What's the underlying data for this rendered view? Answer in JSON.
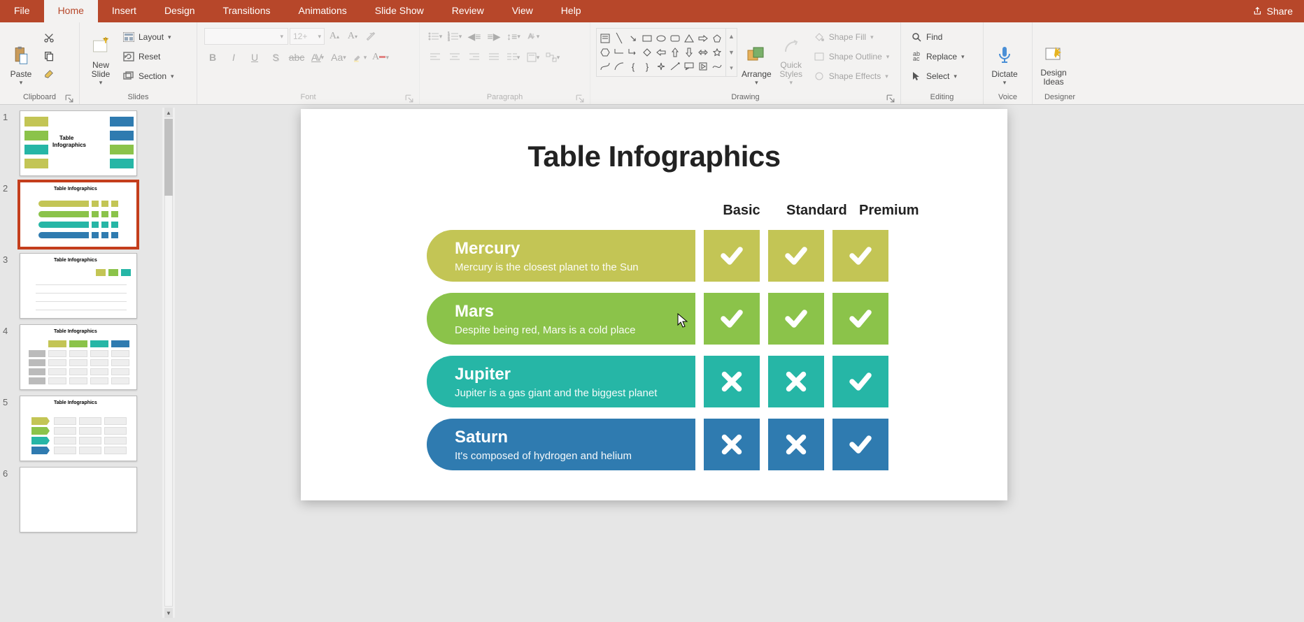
{
  "tabs": [
    "File",
    "Home",
    "Insert",
    "Design",
    "Transitions",
    "Animations",
    "Slide Show",
    "Review",
    "View",
    "Help"
  ],
  "active_tab": "Home",
  "share": "Share",
  "groups": {
    "clipboard": "Clipboard",
    "slides": "Slides",
    "font": "Font",
    "paragraph": "Paragraph",
    "drawing": "Drawing",
    "editing": "Editing",
    "voice": "Voice",
    "designer": "Designer"
  },
  "ribbon": {
    "paste": "Paste",
    "new_slide": "New\nSlide",
    "layout": "Layout",
    "reset": "Reset",
    "section": "Section",
    "font_name": "",
    "font_size": "12+",
    "arrange": "Arrange",
    "quick_styles": "Quick\nStyles",
    "shape_fill": "Shape Fill",
    "shape_outline": "Shape Outline",
    "shape_effects": "Shape Effects",
    "find": "Find",
    "replace": "Replace",
    "select": "Select",
    "dictate": "Dictate",
    "design_ideas": "Design\nIdeas"
  },
  "thumbnails": [
    {
      "n": 1,
      "title": "Table Infographics"
    },
    {
      "n": 2,
      "title": "Table Infographics"
    },
    {
      "n": 3,
      "title": "Table Infographics"
    },
    {
      "n": 4,
      "title": "Table Infographics"
    },
    {
      "n": 5,
      "title": "Table Infographics"
    },
    {
      "n": 6,
      "title": ""
    }
  ],
  "selected_thumb": 2,
  "slide": {
    "title": "Table Infographics",
    "columns": [
      "Basic",
      "Standard",
      "Premium"
    ],
    "rows": [
      {
        "title": "Mercury",
        "sub": "Mercury is the closest planet to the Sun",
        "color": "c-olive",
        "cells": [
          "check",
          "check",
          "check"
        ]
      },
      {
        "title": "Mars",
        "sub": "Despite being red, Mars is a cold place",
        "color": "c-green",
        "cells": [
          "check",
          "check",
          "check"
        ]
      },
      {
        "title": "Jupiter",
        "sub": "Jupiter is a gas giant and the biggest planet",
        "color": "c-teal",
        "cells": [
          "cross",
          "cross",
          "check"
        ]
      },
      {
        "title": "Saturn",
        "sub": "It's composed of hydrogen and helium",
        "color": "c-blue",
        "cells": [
          "cross",
          "cross",
          "check"
        ]
      }
    ]
  }
}
